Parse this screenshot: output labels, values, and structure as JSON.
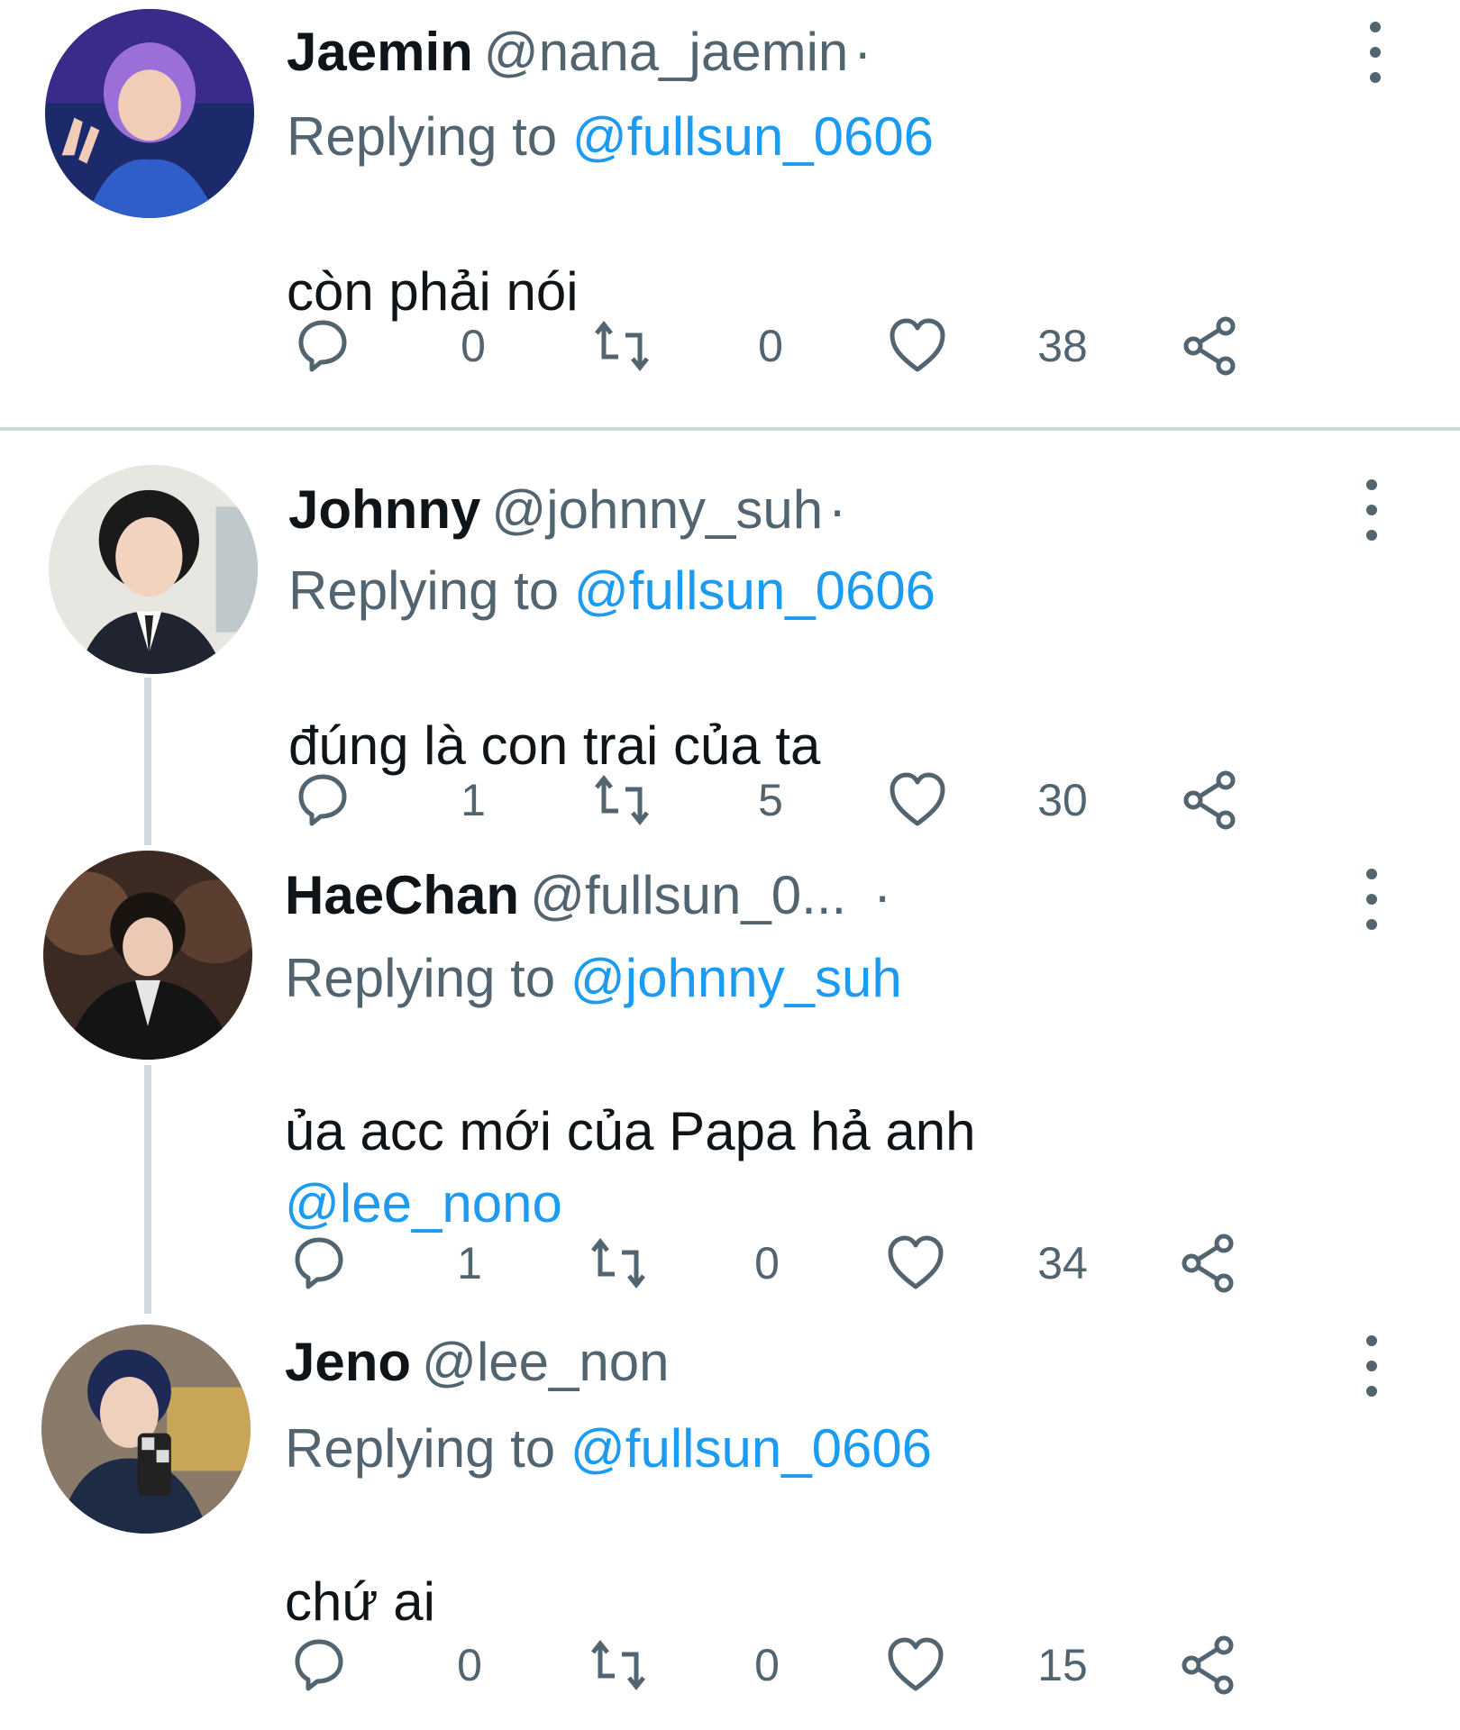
{
  "tweets": [
    {
      "display_name": "Jaemin",
      "handle": "@nana_jaemin",
      "dot": "·",
      "replying_prefix": "Replying to ",
      "replying_to": "@fullsun_0606",
      "text": "còn phải nói",
      "mention": "",
      "replies": "0",
      "retweets": "0",
      "likes": "38"
    },
    {
      "display_name": "Johnny",
      "handle": "@johnny_suh",
      "dot": "·",
      "replying_prefix": "Replying to ",
      "replying_to": "@fullsun_0606",
      "text": "đúng là con trai của ta",
      "mention": "",
      "replies": "1",
      "retweets": "5",
      "likes": "30"
    },
    {
      "display_name": "HaeChan",
      "handle": "@fullsun_0...",
      "dot": "·",
      "replying_prefix": "Replying to ",
      "replying_to": "@johnny_suh",
      "text": "ủa acc mới của Papa hả anh",
      "mention": "@lee_nono",
      "replies": "1",
      "retweets": "0",
      "likes": "34"
    },
    {
      "display_name": "Jeno",
      "handle": "@lee_non",
      "dot": "",
      "replying_prefix": "Replying to ",
      "replying_to": "@fullsun_0606",
      "text": "chứ ai",
      "mention": "",
      "replies": "0",
      "retweets": "0",
      "likes": "15"
    }
  ],
  "icons": {
    "reply": "reply-icon",
    "retweet": "retweet-icon",
    "like": "heart-icon",
    "share": "share-icon",
    "more": "more-vertical-icon"
  },
  "colors": {
    "link": "#1d9bf0",
    "secondary_text": "#536471",
    "primary_text": "#0f1419",
    "divider": "#cfd9de"
  }
}
